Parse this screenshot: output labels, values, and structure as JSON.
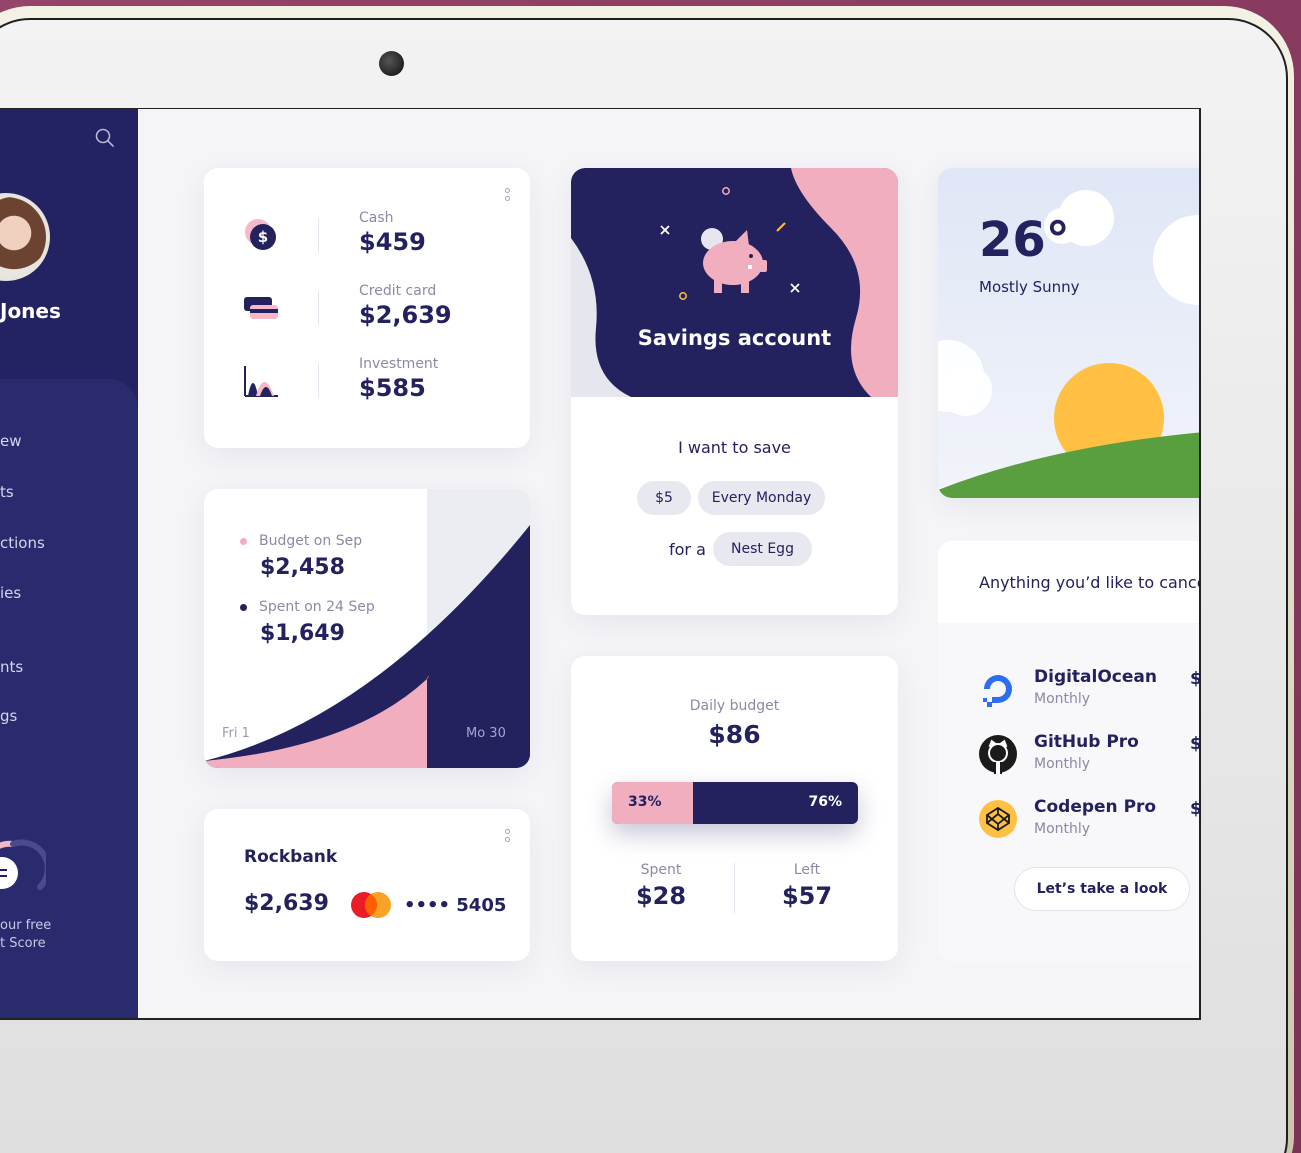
{
  "user": {
    "name": "Jones"
  },
  "nav": [
    "ew",
    "ts",
    "ctions",
    "ies",
    "nts",
    "gs"
  ],
  "credit": {
    "line1": "our free",
    "line2": "t Score"
  },
  "accounts": [
    {
      "label": "Cash",
      "value": "$459",
      "icon": "dollar-coin-icon"
    },
    {
      "label": "Credit card",
      "value": "$2,639",
      "icon": "credit-card-icon"
    },
    {
      "label": "Investment",
      "value": "$585",
      "icon": "investment-chart-icon"
    }
  ],
  "budget_chart": {
    "budget_label": "Budget on Sep",
    "budget_value": "$2,458",
    "spent_label": "Spent on 24 Sep",
    "spent_value": "$1,649",
    "start_label": "Fri 1",
    "end_label": "Mo 30"
  },
  "rockbank": {
    "name": "Rockbank",
    "amount": "$2,639",
    "card_mask": "•••• 5405"
  },
  "savings": {
    "title": "Savings account",
    "want_text": "I want to save",
    "amount": "$5",
    "frequency": "Every Monday",
    "for_text": "for a",
    "goal": "Nest Egg"
  },
  "daily_budget": {
    "label": "Daily budget",
    "value": "$86",
    "spent_pct_label": "33%",
    "left_pct_label": "76%",
    "spent_fraction": 0.33,
    "spent_label": "Spent",
    "spent_value": "$28",
    "left_label": "Left",
    "left_value": "$57"
  },
  "weather": {
    "temp": "26°",
    "condition": "Mostly Sunny"
  },
  "subscriptions": {
    "prompt": "Anything you’d like to cancel",
    "items": [
      {
        "name": "DigitalOcean",
        "period": "Monthly",
        "price": "$",
        "icon": "digitalocean-icon"
      },
      {
        "name": "GitHub Pro",
        "period": "Monthly",
        "price": "$",
        "icon": "github-icon"
      },
      {
        "name": "Codepen Pro",
        "period": "Monthly",
        "price": "$",
        "icon": "codepen-icon"
      }
    ],
    "button": "Let’s take a look"
  },
  "colors": {
    "navy": "#23215e",
    "pink": "#f0aebf",
    "sun": "#ffc043",
    "grass": "#5a9f3f",
    "accent_blue": "#2c6ef2"
  }
}
